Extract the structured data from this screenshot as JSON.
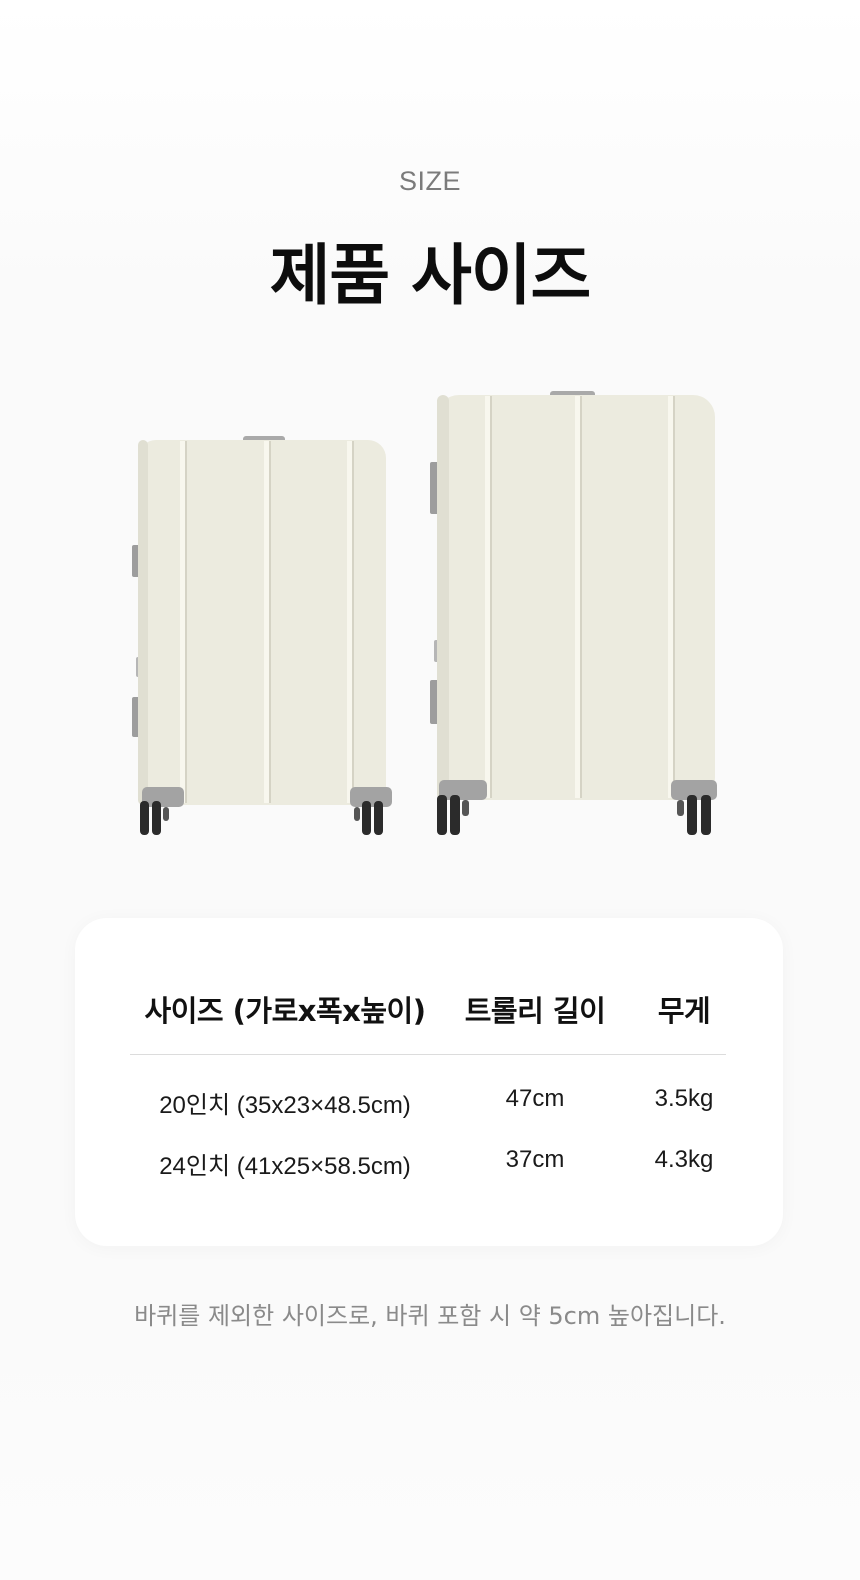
{
  "header": {
    "eyebrow": "SIZE",
    "title": "제품 사이즈"
  },
  "table": {
    "columns": [
      "사이즈 (가로x폭x높이)",
      "트롤리 길이",
      "무게"
    ],
    "rows": [
      [
        "20인치 (35x23×48.5cm)",
        "47cm",
        "3.5kg"
      ],
      [
        "24인치 (41x25×58.5cm)",
        "37cm",
        "4.3kg"
      ]
    ]
  },
  "note": "바퀴를 제외한 사이즈로, 바퀴 포함 시 약 5cm 높아집니다.",
  "colors": {
    "suitcase_body": "#ecebdf",
    "suitcase_edge": "#d9d7c9",
    "wheel": "#2b2b2b",
    "wheel_housing": "#9a9a9a"
  }
}
